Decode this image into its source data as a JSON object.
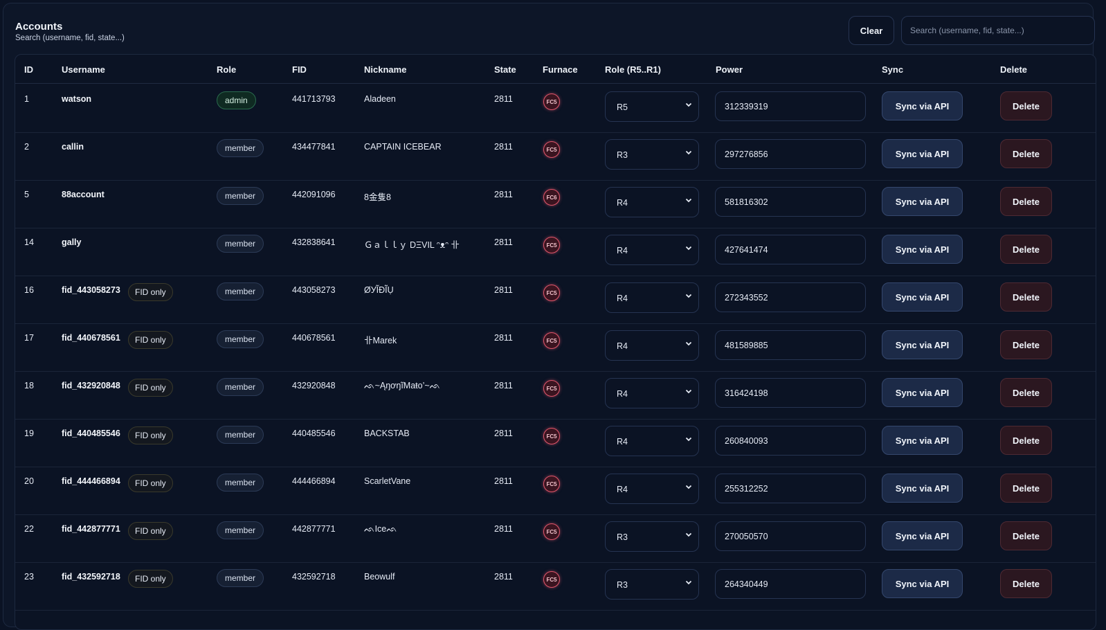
{
  "header": {
    "title": "Accounts",
    "subtitle": "Search (username, fid, state...)",
    "clear_label": "Clear",
    "search_placeholder": "Search (username, fid, state...)"
  },
  "columns": [
    "ID",
    "Username",
    "Role",
    "FID",
    "Nickname",
    "State",
    "Furnace",
    "Role (R5..R1)",
    "Power",
    "Sync",
    "Delete"
  ],
  "colors": {
    "background": "#0b1324",
    "admin_pill": "#2a6b4e",
    "furnace_ring": "#e1566b",
    "sync_button": "#1c2a47",
    "delete_button": "#2b1720"
  },
  "rows": [
    {
      "id": "1",
      "username": "watson",
      "fid_only": "",
      "role": "admin",
      "fid": "441713793",
      "nickname": "Aladeen",
      "state": "2811",
      "furnace": "FC5",
      "role_rank": "R5",
      "power": "312339319",
      "sync_label": "Sync via API",
      "delete_label": "Delete"
    },
    {
      "id": "2",
      "username": "callin",
      "fid_only": "",
      "role": "member",
      "fid": "434477841",
      "nickname": "CAPTAIN ICEBEAR",
      "state": "2811",
      "furnace": "FC5",
      "role_rank": "R3",
      "power": "297276856",
      "sync_label": "Sync via API",
      "delete_label": "Delete"
    },
    {
      "id": "5",
      "username": "88account",
      "fid_only": "",
      "role": "member",
      "fid": "442091096",
      "nickname": "8金隻8",
      "state": "2811",
      "furnace": "FC6",
      "role_rank": "R4",
      "power": "581816302",
      "sync_label": "Sync via API",
      "delete_label": "Delete"
    },
    {
      "id": "14",
      "username": "gally",
      "fid_only": "",
      "role": "member",
      "fid": "432838641",
      "nickname": "Ｇａｌｌｙ DΞVIL ᵔᴥᵔ 卝",
      "state": "2811",
      "furnace": "FC5",
      "role_rank": "R4",
      "power": "427641474",
      "sync_label": "Sync via API",
      "delete_label": "Delete"
    },
    {
      "id": "16",
      "username": "fid_443058273",
      "fid_only": "FID only",
      "role": "member",
      "fid": "443058273",
      "nickname": "ØУĨĐĨỤ",
      "state": "2811",
      "furnace": "FC5",
      "role_rank": "R4",
      "power": "272343552",
      "sync_label": "Sync via API",
      "delete_label": "Delete"
    },
    {
      "id": "17",
      "username": "fid_440678561",
      "fid_only": "FID only",
      "role": "member",
      "fid": "440678561",
      "nickname": "卝Marek",
      "state": "2811",
      "furnace": "FC5",
      "role_rank": "R4",
      "power": "481589885",
      "sync_label": "Sync via API",
      "delete_label": "Delete"
    },
    {
      "id": "18",
      "username": "fid_432920848",
      "fid_only": "FID only",
      "role": "member",
      "fid": "432920848",
      "nickname": "ᨒ~ĄŋơŋĩMaŧo’~ᨒ",
      "state": "2811",
      "furnace": "FC5",
      "role_rank": "R4",
      "power": "316424198",
      "sync_label": "Sync via API",
      "delete_label": "Delete"
    },
    {
      "id": "19",
      "username": "fid_440485546",
      "fid_only": "FID only",
      "role": "member",
      "fid": "440485546",
      "nickname": "BACKSTAB",
      "state": "2811",
      "furnace": "FC5",
      "role_rank": "R4",
      "power": "260840093",
      "sync_label": "Sync via API",
      "delete_label": "Delete"
    },
    {
      "id": "20",
      "username": "fid_444466894",
      "fid_only": "FID only",
      "role": "member",
      "fid": "444466894",
      "nickname": "ScarletVane",
      "state": "2811",
      "furnace": "FC5",
      "role_rank": "R4",
      "power": "255312252",
      "sync_label": "Sync via API",
      "delete_label": "Delete"
    },
    {
      "id": "22",
      "username": "fid_442877771",
      "fid_only": "FID only",
      "role": "member",
      "fid": "442877771",
      "nickname": "ᨒIceᨒ",
      "state": "2811",
      "furnace": "FC5",
      "role_rank": "R3",
      "power": "270050570",
      "sync_label": "Sync via API",
      "delete_label": "Delete"
    },
    {
      "id": "23",
      "username": "fid_432592718",
      "fid_only": "FID only",
      "role": "member",
      "fid": "432592718",
      "nickname": "Beowulf",
      "state": "2811",
      "furnace": "FC5",
      "role_rank": "R3",
      "power": "264340449",
      "sync_label": "Sync via API",
      "delete_label": "Delete"
    }
  ]
}
